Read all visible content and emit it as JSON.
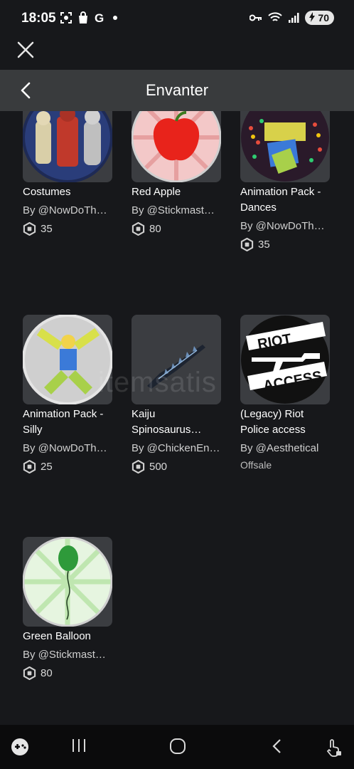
{
  "status": {
    "time": "18:05",
    "battery": "70"
  },
  "header": {
    "title": "Envanter"
  },
  "watermark": "itemsatis",
  "items": [
    {
      "name": "Costumes",
      "creator": "By @NowDoTh…",
      "price": "35"
    },
    {
      "name": "Red Apple",
      "creator": "By @Stickmast…",
      "price": "80"
    },
    {
      "name": "Animation Pack - Dances",
      "creator": "By @NowDoTh…",
      "price": "35"
    },
    {
      "name": "Animation Pack - Silly",
      "creator": "By @NowDoTh…",
      "price": "25"
    },
    {
      "name": "Kaiju Spinosaurus…",
      "creator": "By @ChickenEn…",
      "price": "500"
    },
    {
      "name": "(Legacy) Riot Police access",
      "creator": "By @Aesthetical",
      "status": "Offsale"
    },
    {
      "name": "Green Balloon",
      "creator": "By @Stickmast…",
      "price": "80"
    }
  ],
  "thumb_text": {
    "riot_line1": "RIOT",
    "riot_line2": "ACCESS"
  },
  "icons": {
    "close": "close-icon",
    "back": "chevron-left-icon",
    "robux": "robux-icon",
    "nav": [
      "gamepad-icon",
      "recent-apps-icon",
      "home-icon",
      "back-icon",
      "accessibility-icon"
    ]
  },
  "colors": {
    "background": "#17181b",
    "header": "#393b3d",
    "tile": "#3b3d41"
  }
}
